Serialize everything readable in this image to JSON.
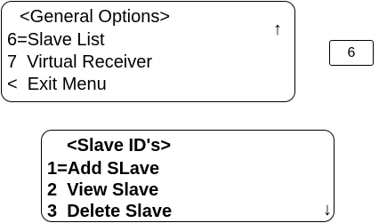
{
  "general_options": {
    "title": "<General Options>",
    "lines": [
      "6=Slave List",
      "7  Virtual Receiver",
      "<  Exit Menu"
    ],
    "scroll_indicator": "↑"
  },
  "key": {
    "label": "6"
  },
  "slave_ids": {
    "title": "<Slave ID's>",
    "lines": [
      "1=Add SLave",
      "2  View Slave",
      "3  Delete Slave"
    ],
    "scroll_indicator": "↓"
  }
}
